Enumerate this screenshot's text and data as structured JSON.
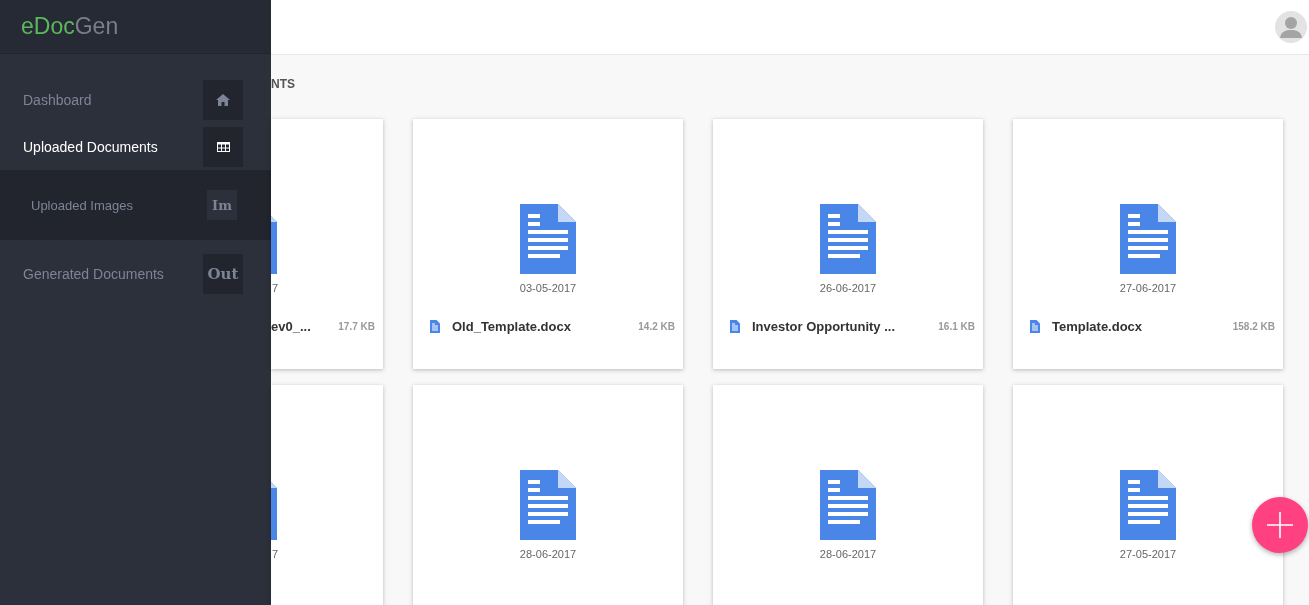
{
  "logo": {
    "part_1": "eDoc",
    "part_2": "Gen"
  },
  "sidebar": {
    "items": [
      {
        "label": "Dashboard",
        "selected": false,
        "kind": "home"
      },
      {
        "label": "Uploaded Documents",
        "selected": true,
        "kind": "grid",
        "children": [
          {
            "label": "Uploaded Images",
            "selected": false,
            "kind": "text",
            "badge": "Im"
          }
        ]
      },
      {
        "label": "Generated Documents",
        "selected": false,
        "kind": "text",
        "badge": "Out"
      }
    ]
  },
  "heading": "NTS",
  "rows": [
    [
      {
        "kind": "partial",
        "date": "7",
        "name": "ev0_...",
        "size": "17.7 KB"
      },
      {
        "kind": "full",
        "date": "03-05-2017",
        "name": "Old_Template.docx",
        "size": "14.2 KB"
      },
      {
        "kind": "full",
        "date": "26-06-2017",
        "name": "Investor Opportunity ...",
        "size": "16.1 KB"
      },
      {
        "kind": "full",
        "date": "27-06-2017",
        "name": "Template.docx",
        "size": "158.2 KB"
      }
    ],
    [
      {
        "kind": "partial",
        "date": "7"
      },
      {
        "kind": "full",
        "date": "28-06-2017"
      },
      {
        "kind": "full",
        "date": "28-06-2017"
      },
      {
        "kind": "full",
        "date": "27-05-2017"
      }
    ]
  ]
}
